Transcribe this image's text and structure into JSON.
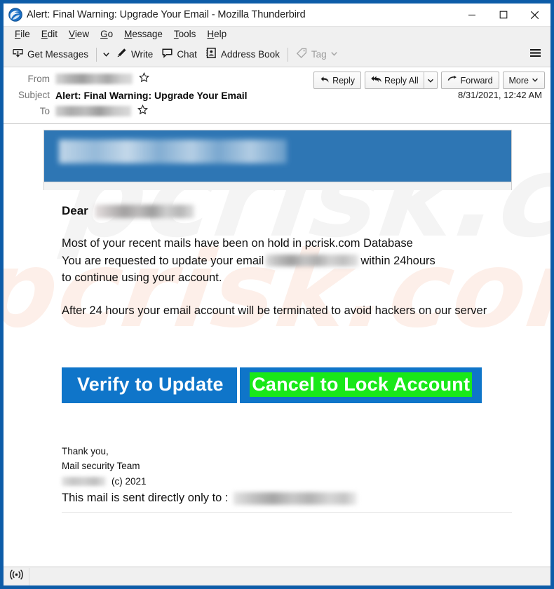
{
  "window": {
    "title": "Alert: Final Warning: Upgrade Your Email - Mozilla Thunderbird",
    "app_icon": "thunderbird-icon",
    "minimize_label": "–",
    "maximize_label": "□",
    "close_label": "✕",
    "accent_color": "#0d5ca8"
  },
  "menubar": {
    "items": [
      {
        "label": "File",
        "accesskey": "F"
      },
      {
        "label": "Edit",
        "accesskey": "E"
      },
      {
        "label": "View",
        "accesskey": "V"
      },
      {
        "label": "Go",
        "accesskey": "G"
      },
      {
        "label": "Message",
        "accesskey": "M"
      },
      {
        "label": "Tools",
        "accesskey": "T"
      },
      {
        "label": "Help",
        "accesskey": "H"
      }
    ]
  },
  "toolbar": {
    "get_messages": "Get Messages",
    "write": "Write",
    "chat": "Chat",
    "address_book": "Address Book",
    "tag": "Tag",
    "tag_disabled": true,
    "app_menu_icon": "hamburger-icon"
  },
  "message_header": {
    "from_label": "From",
    "from_value_redacted": true,
    "subject_label": "Subject",
    "subject_value": "Alert: Final Warning: Upgrade Your Email",
    "to_label": "To",
    "to_value_redacted": true,
    "date": "8/31/2021, 12:42 AM",
    "actions": {
      "reply": "Reply",
      "reply_all": "Reply All",
      "forward": "Forward",
      "more": "More"
    }
  },
  "email": {
    "banner": {
      "background_color": "#2e76b4",
      "address_redacted": true
    },
    "greeting_word": "Dear",
    "greeting_recipient_redacted": true,
    "paragraphs": [
      {
        "id": "para-hold",
        "line1": "Most of your recent mails have been on hold in pcrisk.com Database",
        "line2_pre": "You are requested to update your email",
        "line2_redacted": true,
        "line2_post": "within 24hours",
        "line3": "to continue using your account."
      },
      {
        "id": "para-terminate",
        "text": "After 24 hours your email account will be terminated to avoid hackers on our server"
      }
    ],
    "buttons": {
      "verify": {
        "label": "Verify to Update",
        "background_color": "#0f75c9",
        "text_color": "#ffffff"
      },
      "cancel": {
        "label": "Cancel to Lock Account",
        "background_color": "#0f75c9",
        "highlight_color": "#19e819",
        "text_color": "#ffffff"
      }
    },
    "signoff": {
      "thanks": "Thank you,",
      "team": "Mail security Team",
      "company_redacted": true,
      "copyright": "(c) 2021",
      "final_line": "This mail is sent directly only to :",
      "final_redacted": true
    },
    "watermark_text": "pcrisk.com"
  },
  "status_bar": {
    "icon": "broadcast-icon",
    "text": ""
  }
}
